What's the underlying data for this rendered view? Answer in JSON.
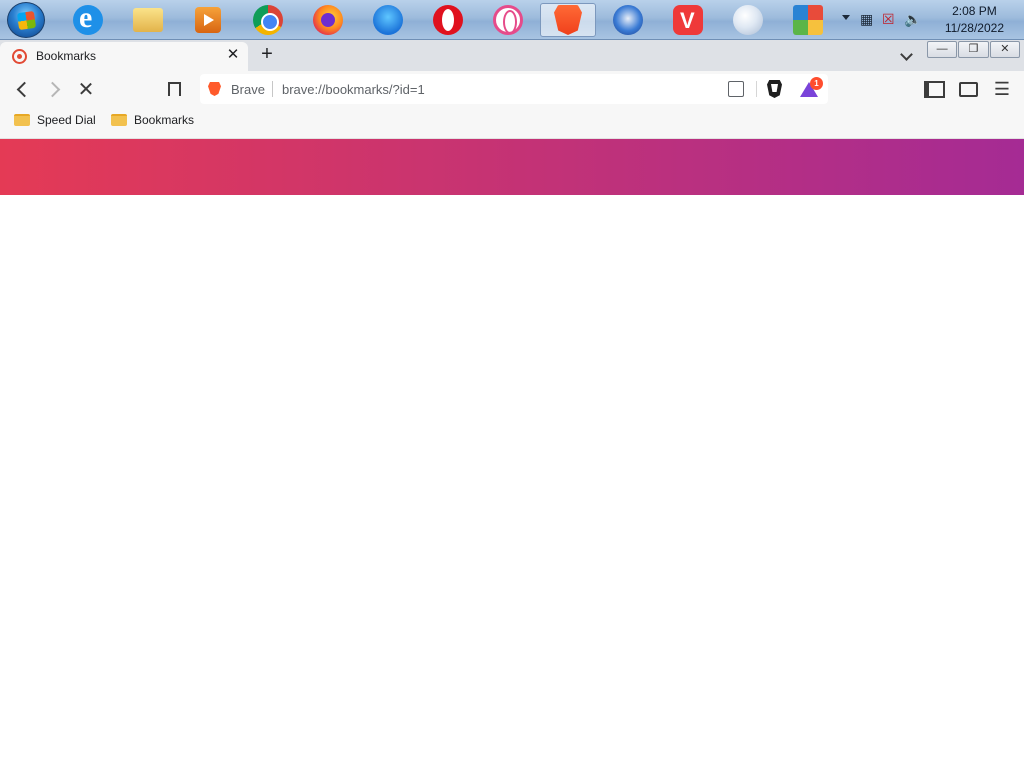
{
  "taskbar": {
    "apps": [
      {
        "name": "internet-explorer-icon"
      },
      {
        "name": "file-explorer-icon"
      },
      {
        "name": "media-player-icon"
      },
      {
        "name": "chrome-icon"
      },
      {
        "name": "firefox-icon"
      },
      {
        "name": "firefox-developer-icon"
      },
      {
        "name": "opera-icon"
      },
      {
        "name": "opera-gx-icon"
      },
      {
        "name": "brave-icon",
        "active": true
      },
      {
        "name": "thunderbird-icon"
      },
      {
        "name": "vivaldi-icon"
      },
      {
        "name": "sphere-icon"
      },
      {
        "name": "avg-icon"
      }
    ],
    "clock": {
      "time": "2:08 PM",
      "date": "11/28/2022"
    }
  },
  "browser": {
    "tab": {
      "title": "Bookmarks"
    },
    "omnibox": {
      "site_label": "Brave",
      "url": "brave://bookmarks/?id=1"
    },
    "rewards_badge": "1",
    "bookmarks": [
      {
        "label": "Speed Dial"
      },
      {
        "label": "Bookmarks"
      }
    ],
    "colors": {
      "hero_start": "#e43a55",
      "hero_end": "#a52b94",
      "accent": "#ff5a2b"
    }
  }
}
